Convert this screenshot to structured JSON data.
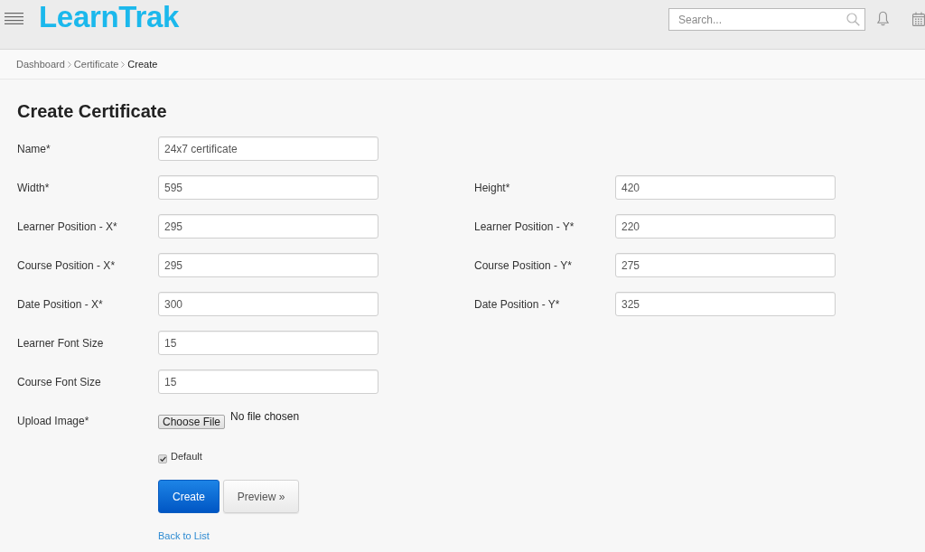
{
  "header": {
    "logo": "LearnTrak",
    "search": {
      "placeholder": "Search..."
    }
  },
  "breadcrumb": [
    {
      "label": "Dashboard",
      "current": false
    },
    {
      "label": "Certificate",
      "current": false
    },
    {
      "label": "Create",
      "current": true
    }
  ],
  "title": "Create Certificate",
  "form": {
    "rows": [
      {
        "fields": [
          {
            "label": "Name*",
            "value": "24x7 certificate"
          }
        ]
      },
      {
        "fields": [
          {
            "label": "Width*",
            "value": "595"
          },
          {
            "label": "Height*",
            "value": "420"
          }
        ]
      },
      {
        "fields": [
          {
            "label": "Learner Position - X*",
            "value": "295"
          },
          {
            "label": "Learner Position - Y*",
            "value": "220"
          }
        ]
      },
      {
        "fields": [
          {
            "label": "Course Position - X*",
            "value": "295"
          },
          {
            "label": "Course Position - Y*",
            "value": "275"
          }
        ]
      },
      {
        "fields": [
          {
            "label": "Date Position - X*",
            "value": "300"
          },
          {
            "label": "Date Position - Y*",
            "value": "325"
          }
        ]
      },
      {
        "fields": [
          {
            "label": "Learner Font Size",
            "value": "15"
          }
        ]
      },
      {
        "fields": [
          {
            "label": "Course Font Size",
            "value": "15"
          }
        ]
      }
    ],
    "upload": {
      "label": "Upload Image*",
      "button": "Choose File",
      "status": "No file chosen"
    },
    "default_option": {
      "label": "Default",
      "checked": true
    },
    "actions": [
      {
        "label": "Create",
        "kind": "primary"
      },
      {
        "label": "Preview »",
        "kind": "secondary"
      }
    ],
    "back_link": "Back to List"
  }
}
